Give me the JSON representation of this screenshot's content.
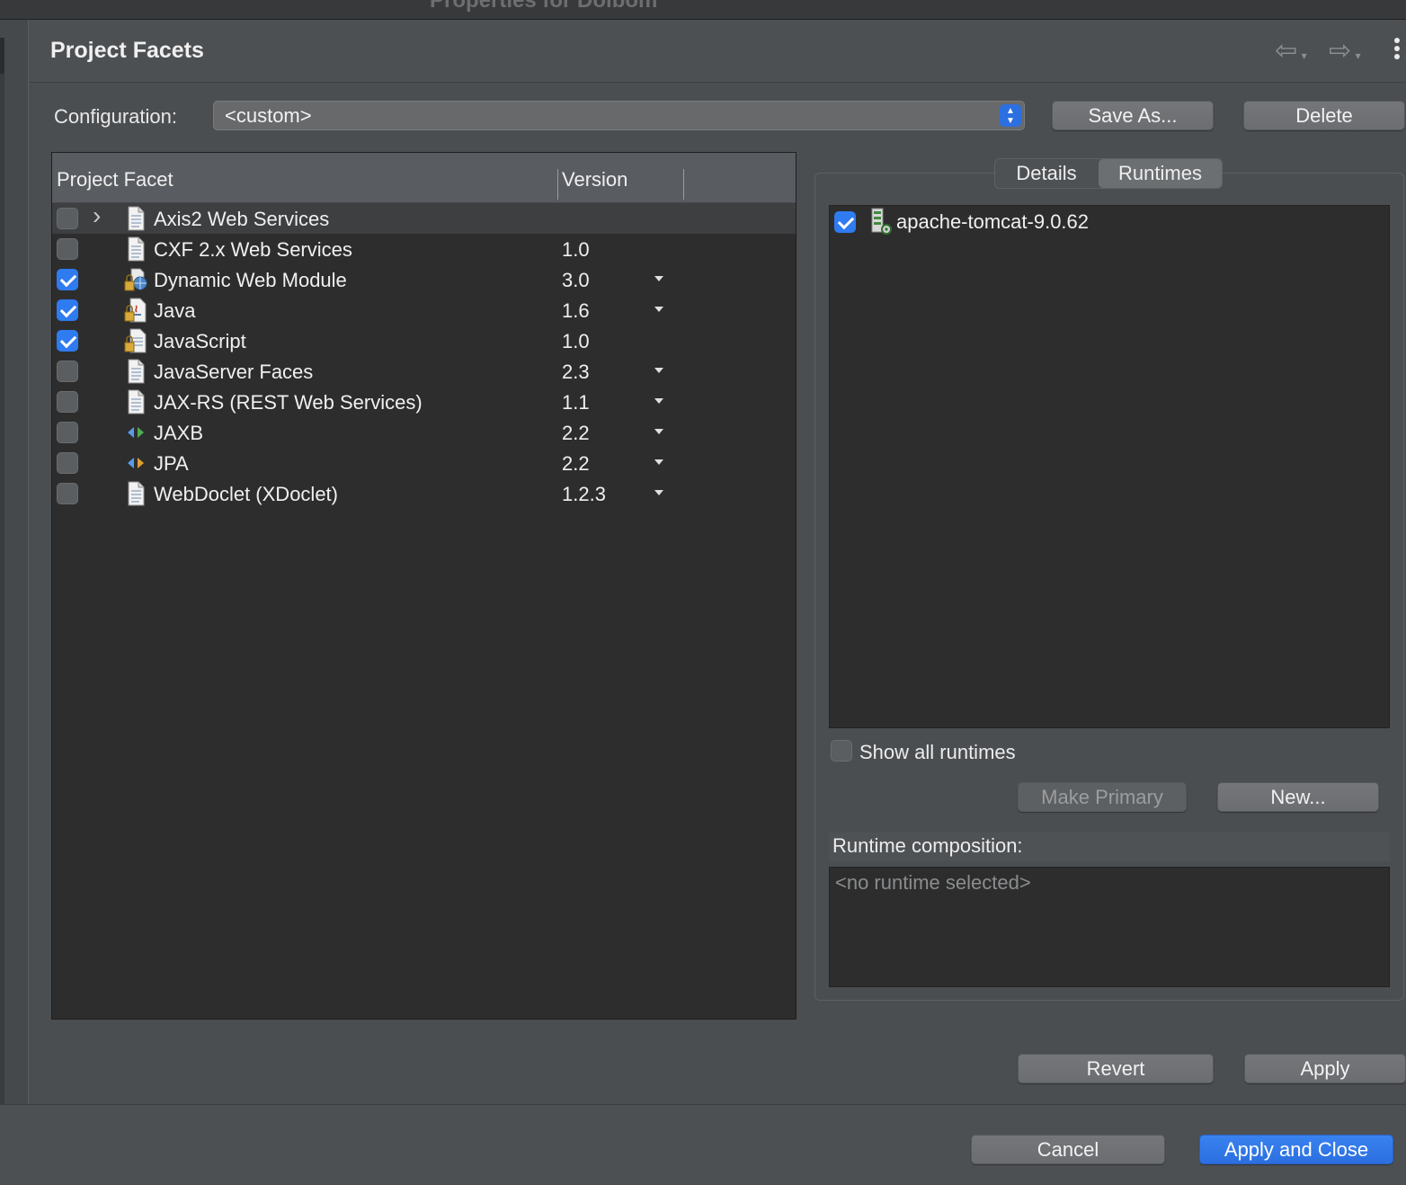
{
  "window": {
    "title": "Properties for Dolbom"
  },
  "page": {
    "title": "Project Facets"
  },
  "config": {
    "label": "Configuration:",
    "value": "<custom>",
    "save_as": "Save As...",
    "delete": "Delete"
  },
  "facets": {
    "col_facet": "Project Facet",
    "col_version": "Version",
    "rows": [
      {
        "name": "Axis2 Web Services",
        "version": "",
        "checked": false,
        "expandable": true,
        "icon": "document-icon",
        "dropdown": false
      },
      {
        "name": "CXF 2.x Web Services",
        "version": "1.0",
        "checked": false,
        "icon": "document-icon",
        "dropdown": false
      },
      {
        "name": "Dynamic Web Module",
        "version": "3.0",
        "checked": true,
        "icon": "locked-web-module-icon",
        "dropdown": true
      },
      {
        "name": "Java",
        "version": "1.6",
        "checked": true,
        "icon": "locked-java-icon",
        "dropdown": true
      },
      {
        "name": "JavaScript",
        "version": "1.0",
        "checked": true,
        "icon": "locked-document-icon",
        "dropdown": false
      },
      {
        "name": "JavaServer Faces",
        "version": "2.3",
        "checked": false,
        "icon": "document-icon",
        "dropdown": true
      },
      {
        "name": "JAX-RS (REST Web Services)",
        "version": "1.1",
        "checked": false,
        "icon": "document-icon",
        "dropdown": true
      },
      {
        "name": "JAXB",
        "version": "2.2",
        "checked": false,
        "icon": "jaxb-icon",
        "dropdown": true
      },
      {
        "name": "JPA",
        "version": "2.2",
        "checked": false,
        "icon": "jpa-icon",
        "dropdown": true
      },
      {
        "name": "WebDoclet (XDoclet)",
        "version": "1.2.3",
        "checked": false,
        "icon": "document-icon",
        "dropdown": true
      }
    ]
  },
  "tabs": {
    "details": "Details",
    "runtimes": "Runtimes",
    "selected": "Runtimes"
  },
  "runtimes": {
    "items": [
      {
        "name": "apache-tomcat-9.0.62",
        "checked": true
      }
    ],
    "show_all_label": "Show all runtimes",
    "make_primary": "Make Primary",
    "new": "New...",
    "composition_label": "Runtime composition:",
    "composition_empty": "<no runtime selected>"
  },
  "buttons": {
    "revert": "Revert",
    "apply": "Apply",
    "cancel": "Cancel",
    "apply_close": "Apply and Close"
  },
  "colors": {
    "accent": "#2f7bf0",
    "background": "#4b4e51",
    "list_background": "#2d2d2d"
  }
}
